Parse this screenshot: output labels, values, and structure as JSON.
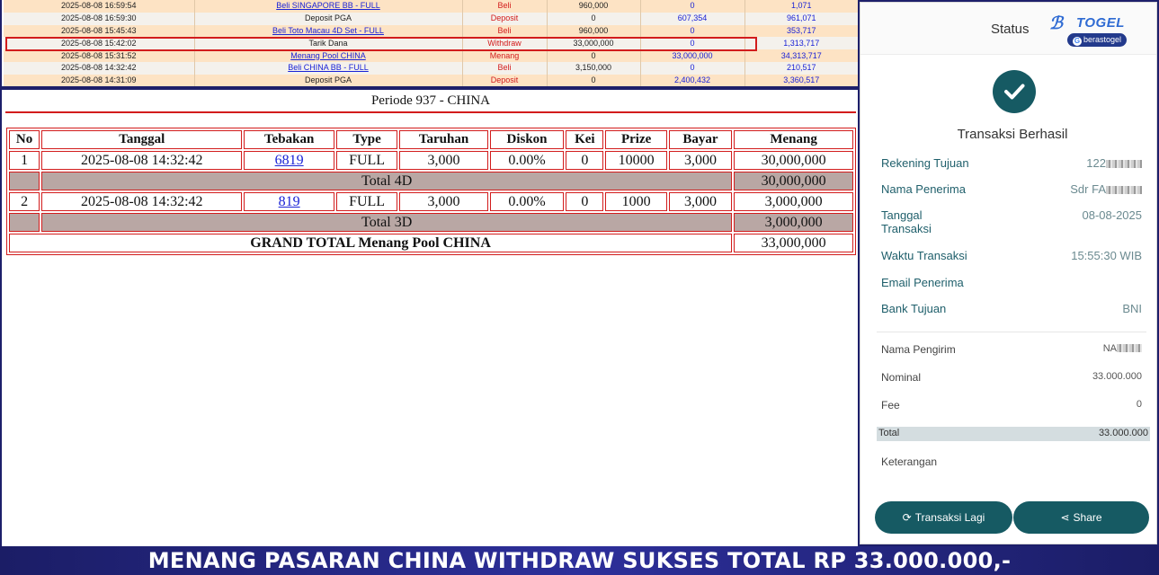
{
  "history": [
    {
      "date": "2025-08-08 16:59:54",
      "desc": "Beli SINGAPORE BB - FULL",
      "link": true,
      "type": "Beli",
      "amount": "960,000",
      "in": "0",
      "balance": "1,071"
    },
    {
      "date": "2025-08-08 16:59:30",
      "desc": "Deposit PGA",
      "link": false,
      "type": "Deposit",
      "amount": "0",
      "in": "607,354",
      "balance": "961,071"
    },
    {
      "date": "2025-08-08 15:45:43",
      "desc": "Beli Toto Macau 4D Set - FULL",
      "link": true,
      "type": "Beli",
      "amount": "960,000",
      "in": "0",
      "balance": "353,717"
    },
    {
      "date": "2025-08-08 15:42:02",
      "desc": "Tarik Dana",
      "link": false,
      "type": "Withdraw",
      "amount": "33,000,000",
      "in": "0",
      "balance": "1,313,717"
    },
    {
      "date": "2025-08-08 15:31:52",
      "desc": "Menang Pool CHINA",
      "link": true,
      "type": "Menang",
      "amount": "0",
      "in": "33,000,000",
      "balance": "34,313,717"
    },
    {
      "date": "2025-08-08 14:32:42",
      "desc": "Beli CHINA BB - FULL",
      "link": true,
      "type": "Beli",
      "amount": "3,150,000",
      "in": "0",
      "balance": "210,517"
    },
    {
      "date": "2025-08-08 14:31:09",
      "desc": "Deposit PGA",
      "link": false,
      "type": "Deposit",
      "amount": "0",
      "in": "2,400,432",
      "balance": "3,360,517"
    }
  ],
  "periode": {
    "title": "Periode 937 - CHINA"
  },
  "bet_table": {
    "headers": [
      "No",
      "Tanggal",
      "Tebakan",
      "Type",
      "Taruhan",
      "Diskon",
      "Kei",
      "Prize",
      "Bayar",
      "Menang"
    ],
    "rows": [
      {
        "no": "1",
        "tanggal": "2025-08-08 14:32:42",
        "tebakan": "6819",
        "type": "FULL",
        "taruhan": "3,000",
        "diskon": "0.00%",
        "kei": "0",
        "prize": "10000",
        "bayar": "3,000",
        "menang": "30,000,000"
      },
      {
        "no": "2",
        "tanggal": "2025-08-08 14:32:42",
        "tebakan": "819",
        "type": "FULL",
        "taruhan": "3,000",
        "diskon": "0.00%",
        "kei": "0",
        "prize": "1000",
        "bayar": "3,000",
        "menang": "3,000,000"
      }
    ],
    "total_4d_label": "Total 4D",
    "total_4d_value": "30,000,000",
    "total_3d_label": "Total 3D",
    "total_3d_value": "3,000,000",
    "grand_label": "GRAND TOTAL  Menang Pool CHINA",
    "grand_value": "33,000,000"
  },
  "receipt": {
    "status_label": "Status",
    "brand": "TOGEL",
    "brand_badge": "berastogel",
    "success_text": "Transaksi Berhasil",
    "rekening_label": "Rekening Tujuan",
    "rekening_value": "122",
    "penerima_label": "Nama Penerima",
    "penerima_value": "Sdr FA",
    "tanggal_label_1": "Tanggal",
    "tanggal_label_2": "Transaksi",
    "tanggal_value": "08-08-2025",
    "waktu_label": "Waktu Transaksi",
    "waktu_value": "15:55:30 WIB",
    "email_label": "Email Penerima",
    "bank_label": "Bank Tujuan",
    "bank_value": "BNI",
    "pengirim_label": "Nama Pengirim",
    "pengirim_value": "NA",
    "nominal_label": "Nominal",
    "nominal_value": "33.000.000",
    "fee_label": "Fee",
    "fee_value": "0",
    "total_label": "Total",
    "total_value": "33.000.000",
    "keterangan_label": "Keterangan",
    "btn_again": "Transaksi Lagi",
    "btn_share": "Share",
    "accent": "#165a63"
  },
  "banner": {
    "text": "MENANG PASARAN CHINA WITHDRAW SUKSES TOTAL RP 33.000.000,-"
  }
}
